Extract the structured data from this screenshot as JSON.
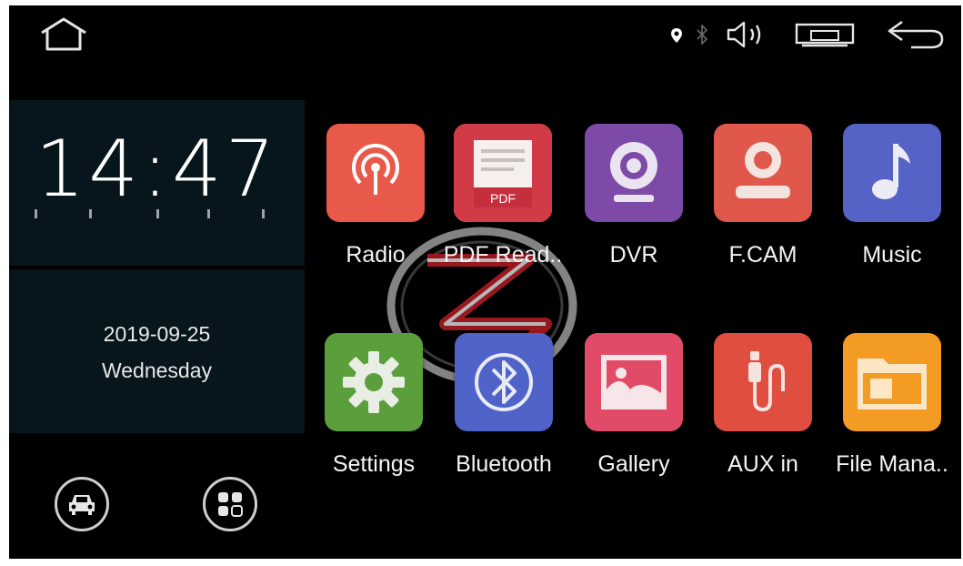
{
  "status_bar": {
    "icons": [
      "home-icon",
      "location-icon",
      "bluetooth-icon",
      "volume-icon",
      "screen-icon",
      "back-icon"
    ]
  },
  "clock": {
    "time": "14:47",
    "date": "2019-09-25",
    "day": "Wednesday"
  },
  "bottom_buttons": [
    "car-icon",
    "apps-grid-icon"
  ],
  "apps": [
    {
      "label": "Radio",
      "icon": "radio-icon",
      "color": "#e9594a"
    },
    {
      "label": "PDF Read..",
      "icon": "pdf-icon",
      "color": "#d23a48"
    },
    {
      "label": "DVR",
      "icon": "webcam-icon",
      "color": "#7d4aa8"
    },
    {
      "label": "F.CAM",
      "icon": "camera-icon",
      "color": "#e0584b"
    },
    {
      "label": "Music",
      "icon": "music-note-icon",
      "color": "#5563c7"
    },
    {
      "label": "Settings",
      "icon": "gear-icon",
      "color": "#5a9f3c"
    },
    {
      "label": "Bluetooth",
      "icon": "bluetooth-icon",
      "color": "#4f63c8"
    },
    {
      "label": "Gallery",
      "icon": "image-icon",
      "color": "#e24b68"
    },
    {
      "label": "AUX in",
      "icon": "aux-cable-icon",
      "color": "#e04e3f"
    },
    {
      "label": "File Mana..",
      "icon": "folder-icon",
      "color": "#f39b22"
    }
  ]
}
